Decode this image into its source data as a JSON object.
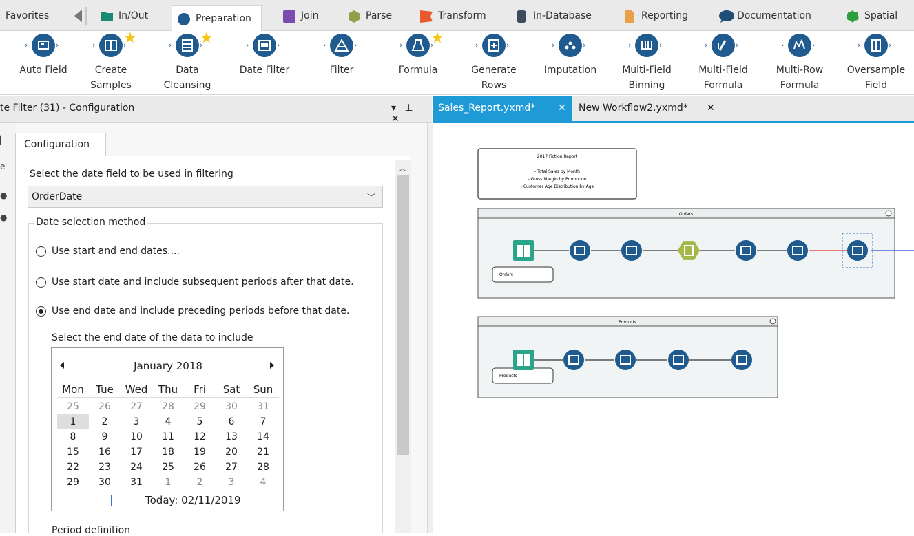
{
  "categories": {
    "favorites": "Favorites",
    "inout": "In/Out",
    "preparation": "Preparation",
    "join": "Join",
    "parse": "Parse",
    "transform": "Transform",
    "indatabase": "In-Database",
    "reporting": "Reporting",
    "documentation": "Documentation",
    "spatial": "Spatial"
  },
  "colors": {
    "inout": "#1a8a74",
    "preparation": "#1f5b8e",
    "join": "#7b4bb0",
    "parse": "#8ea04a",
    "transform": "#e8592c",
    "indatabase": "#3d4b5c",
    "reporting": "#e9a04a",
    "documentation": "#1f4e79",
    "spatial": "#2e9e3e",
    "accent": "#1e9bd7",
    "tool_badge": "#1f5b8e"
  },
  "tools": [
    {
      "label1": "Auto Field",
      "label2": "",
      "star": false,
      "icon": "auto-field-icon"
    },
    {
      "label1": "Create",
      "label2": "Samples",
      "star": true,
      "icon": "create-samples-icon"
    },
    {
      "label1": "Data",
      "label2": "Cleansing",
      "star": true,
      "icon": "data-cleansing-icon"
    },
    {
      "label1": "Date Filter",
      "label2": "",
      "star": false,
      "icon": "date-filter-icon"
    },
    {
      "label1": "Filter",
      "label2": "",
      "star": false,
      "icon": "filter-icon"
    },
    {
      "label1": "Formula",
      "label2": "",
      "star": true,
      "icon": "formula-icon"
    },
    {
      "label1": "Generate",
      "label2": "Rows",
      "star": false,
      "icon": "generate-rows-icon"
    },
    {
      "label1": "Imputation",
      "label2": "",
      "star": false,
      "icon": "imputation-icon"
    },
    {
      "label1": "Multi-Field",
      "label2": "Binning",
      "star": false,
      "icon": "multi-field-binning-icon"
    },
    {
      "label1": "Multi-Field",
      "label2": "Formula",
      "star": false,
      "icon": "multi-field-formula-icon"
    },
    {
      "label1": "Multi-Row",
      "label2": "Formula",
      "star": false,
      "icon": "multi-row-formula-icon"
    },
    {
      "label1": "Oversample",
      "label2": "Field",
      "star": false,
      "icon": "oversample-field-icon"
    }
  ],
  "config": {
    "title": "te Filter (31) - Configuration",
    "pin": "▾ ⊕ ✕",
    "tab": "Configuration",
    "field_prompt": "Select the date field to be used in filtering",
    "field_value": "OrderDate",
    "method_legend": "Date selection method",
    "radios": [
      {
        "label": "Use start and end dates....",
        "selected": false
      },
      {
        "label": "Use start date and include subsequent periods after that date.",
        "selected": false
      },
      {
        "label": "Use end date and include preceding periods before that date.",
        "selected": true
      }
    ],
    "end_date_prompt": "Select the end date of the data to include",
    "period_definition": "Period definition"
  },
  "calendar": {
    "month": "January 2018",
    "weekdays": [
      "Mon",
      "Tue",
      "Wed",
      "Thu",
      "Fri",
      "Sat",
      "Sun"
    ],
    "weeks": [
      [
        "25",
        "26",
        "27",
        "28",
        "29",
        "30",
        "31"
      ],
      [
        "1",
        "2",
        "3",
        "4",
        "5",
        "6",
        "7"
      ],
      [
        "8",
        "9",
        "10",
        "11",
        "12",
        "13",
        "14"
      ],
      [
        "15",
        "16",
        "17",
        "18",
        "19",
        "20",
        "21"
      ],
      [
        "22",
        "23",
        "24",
        "25",
        "26",
        "27",
        "28"
      ],
      [
        "29",
        "30",
        "31",
        "1",
        "2",
        "3",
        "4"
      ]
    ],
    "selected": "1",
    "today": "Today: 02/11/2019"
  },
  "doc_tabs": {
    "active": "Sales_Report.yxmd*",
    "second": "New Workflow2.yxmd*"
  },
  "workflow": {
    "comment_lines": [
      "2017 Fiction Report",
      "- Total Sales by Month",
      "- Gross Margin by Promotion",
      "- Customer Age Distribution by Age"
    ],
    "container1": "Orders",
    "container1_input": "Orders",
    "container2": "Products",
    "container2_input": "Products"
  }
}
